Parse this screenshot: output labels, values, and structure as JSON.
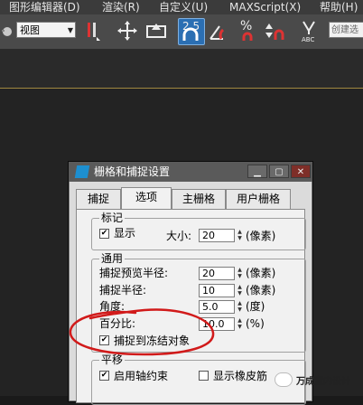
{
  "menubar": {
    "items": [
      "图形编辑器(D)",
      "渲染(R)",
      "自定义(U)",
      "MAXScript(X)",
      "帮助(H)"
    ]
  },
  "toolbar": {
    "view_dropdown": "视图",
    "snap_value": "2.5",
    "percent_label": "%",
    "abc_label": "ABC",
    "selection_set_placeholder": "创建选"
  },
  "dialog": {
    "title": "栅格和捕捉设置",
    "controls": {
      "minimize": "▁",
      "restore": "▢",
      "close": "✕"
    },
    "tabs": [
      "捕捉",
      "选项",
      "主栅格",
      "用户栅格"
    ],
    "active_tab": "选项",
    "marker": {
      "label": "标记",
      "display_label": "显示",
      "display_checked": true,
      "size_label": "大小:",
      "size_value": "20",
      "size_unit": "(像素)"
    },
    "general": {
      "label": "通用",
      "preview_radius_label": "捕捉预览半径:",
      "preview_radius_value": "20",
      "preview_radius_unit": "(像素)",
      "snap_radius_label": "捕捉半径:",
      "snap_radius_value": "10",
      "snap_radius_unit": "(像素)",
      "angle_label": "角度:",
      "angle_value": "5.0",
      "angle_unit": "(度)",
      "percent_label": "百分比:",
      "percent_value": "10.0",
      "percent_unit": "(%)",
      "snap_frozen_label": "捕捉到冻结对象",
      "snap_frozen_checked": true
    },
    "translation": {
      "label": "平移",
      "axis_constraint_label": "启用轴约束",
      "axis_constraint_checked": true,
      "rubber_band_label": "显示橡皮筋",
      "rubber_band_checked": false
    }
  },
  "watermark": {
    "text": "万成室内设计"
  },
  "colors": {
    "annotation_red": "#d11a1a",
    "snap_active_blue": "#2b6fb3"
  }
}
